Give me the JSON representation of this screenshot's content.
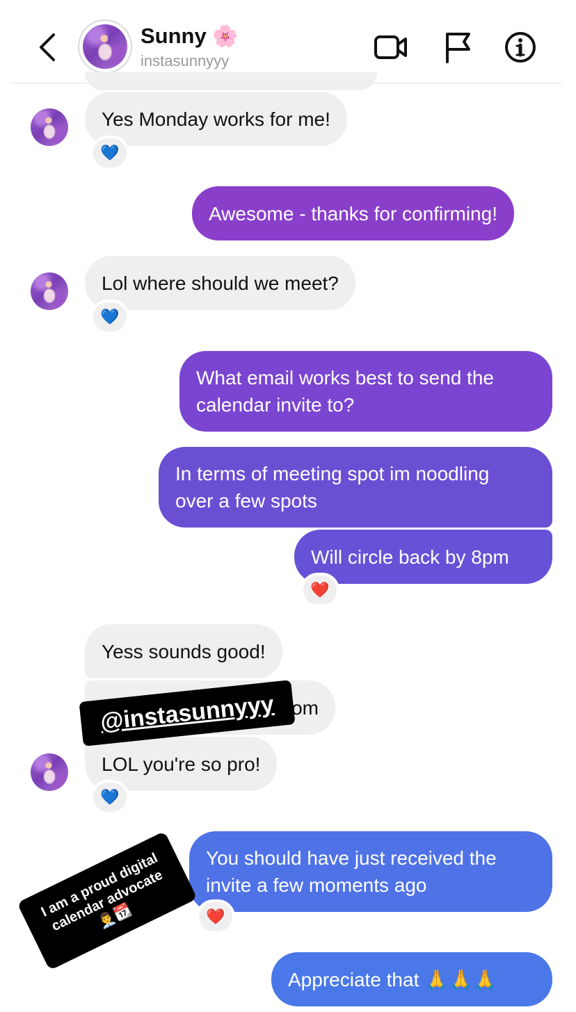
{
  "header": {
    "back_glyph": "‹",
    "name": "Sunny",
    "name_emoji": "🌸",
    "handle": "instasunnyyy",
    "icons": [
      "chevron-left-icon",
      "video-camera-icon",
      "flag-icon",
      "info-icon"
    ]
  },
  "messages": {
    "m1": {
      "text": "Yes Monday works for me!",
      "reaction": "💙"
    },
    "m2": {
      "text": "Awesome - thanks for confirming!"
    },
    "m3": {
      "text": "Lol where should we meet?",
      "reaction": "💙"
    },
    "m4": {
      "text": "What email works best to send the\ncalendar invite to?"
    },
    "m5": {
      "text": "In terms of meeting spot im noodling\nover a few spots"
    },
    "m6": {
      "text": "Will circle back by 8pm",
      "reaction": "❤️"
    },
    "m7": {
      "text": "Yess sounds good!"
    },
    "m8": {
      "text_visible": ".com"
    },
    "m9": {
      "text": "LOL you're so pro!",
      "reaction": "💙"
    },
    "m10": {
      "text": "You should have just received the\ninvite a few moments ago",
      "reaction": "❤️"
    },
    "m11": {
      "text": "Appreciate that 🙏🙏🙏"
    }
  },
  "stickers": {
    "handle": "@instasunnyyy",
    "advocate_line1": "I am a proud digital",
    "advocate_line2": "calendar advocate",
    "advocate_emoji": "👨‍💼📆"
  },
  "colors": {
    "incoming_bubble": "#efefef",
    "outgoing_purple": "#8a3fca",
    "outgoing_violet": "#6e4fd4",
    "outgoing_blue": "#4f72e6",
    "reaction_blue": "#3d8bf2",
    "reaction_red": "#e52d3d"
  }
}
